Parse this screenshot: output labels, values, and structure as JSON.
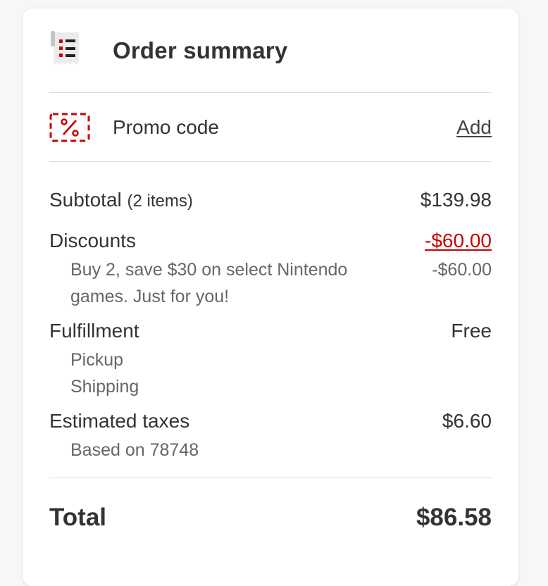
{
  "header": {
    "title": "Order summary",
    "icon": "receipt-icon"
  },
  "promo": {
    "label": "Promo code",
    "action": "Add",
    "icon": "percent-tag-icon"
  },
  "subtotal": {
    "label": "Subtotal",
    "count": "(2 items)",
    "value": "$139.98"
  },
  "discounts": {
    "label": "Discounts",
    "value": "-$60.00",
    "detail": {
      "text": "Buy 2, save $30 on select Nintendo games. Just for you!",
      "value": "-$60.00"
    }
  },
  "fulfillment": {
    "label": "Fulfillment",
    "value": "Free",
    "methods": [
      "Pickup",
      "Shipping"
    ]
  },
  "taxes": {
    "label": "Estimated taxes",
    "value": "$6.60",
    "note": "Based on 78748"
  },
  "total": {
    "label": "Total",
    "value": "$86.58"
  },
  "colors": {
    "accent": "#cc0000",
    "text": "#333333",
    "muted": "#666666"
  }
}
